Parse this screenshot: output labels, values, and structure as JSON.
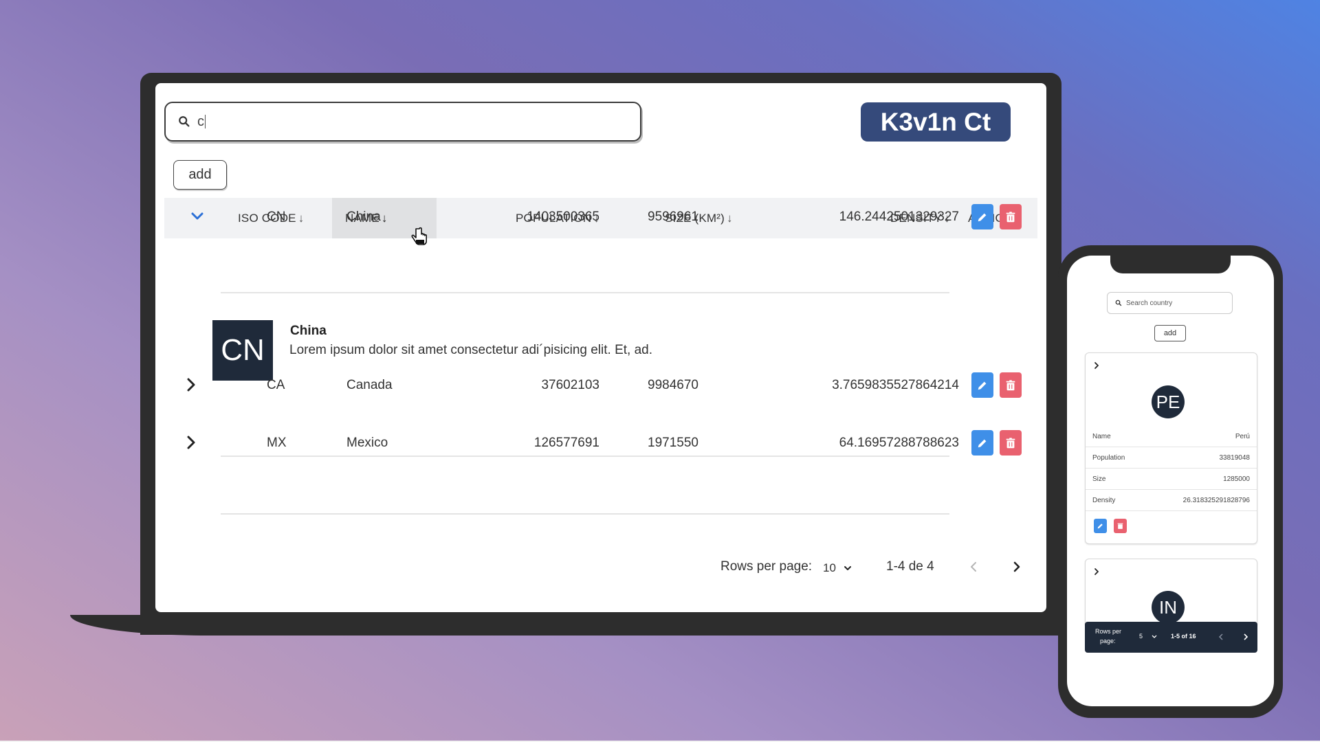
{
  "search": {
    "value": "c"
  },
  "brand": "K3v1n Ct",
  "add_label": "add",
  "columns": {
    "iso": "ISO CODE",
    "name": "NAME",
    "population": "POPULATION",
    "size": "SIZE (KM²)",
    "density": "DENSITY",
    "actions": "ACTIONS"
  },
  "rows": [
    {
      "iso": "CN",
      "name": "China",
      "population": "1403500365",
      "size": "9596961",
      "density": "146.2442501329327",
      "expanded": true
    },
    {
      "iso": "CA",
      "name": "Canada",
      "population": "37602103",
      "size": "9984670",
      "density": "3.7659835527864214",
      "expanded": false
    },
    {
      "iso": "MX",
      "name": "Mexico",
      "population": "126577691",
      "size": "1971550",
      "density": "64.16957288788623",
      "expanded": false
    }
  ],
  "detail": {
    "avatar": "CN",
    "title": "China",
    "description": "Lorem ipsum dolor sit amet consectetur adi´pisicing elit. Et, ad."
  },
  "pagination": {
    "rows_per_page_label": "Rows per page:",
    "rows_per_page": "10",
    "range": "1-4 de 4"
  },
  "phone": {
    "search_placeholder": "Search country",
    "add_label": "add",
    "card1": {
      "avatar": "PE",
      "fields": [
        {
          "label": "Name",
          "value": "Perú"
        },
        {
          "label": "Population",
          "value": "33819048"
        },
        {
          "label": "Size",
          "value": "1285000"
        },
        {
          "label": "Density",
          "value": "26.318325291828796"
        }
      ]
    },
    "card2": {
      "avatar": "IN"
    },
    "pager": {
      "rows_label_1": "Rows per",
      "rows_label_2": "page:",
      "rows_per_page": "5",
      "range": "1-5 of 16"
    }
  },
  "colors": {
    "brand_bg": "#354a7b",
    "edit": "#3f8fe8",
    "delete": "#e9616f",
    "avatar_bg": "#1f2a3a"
  }
}
